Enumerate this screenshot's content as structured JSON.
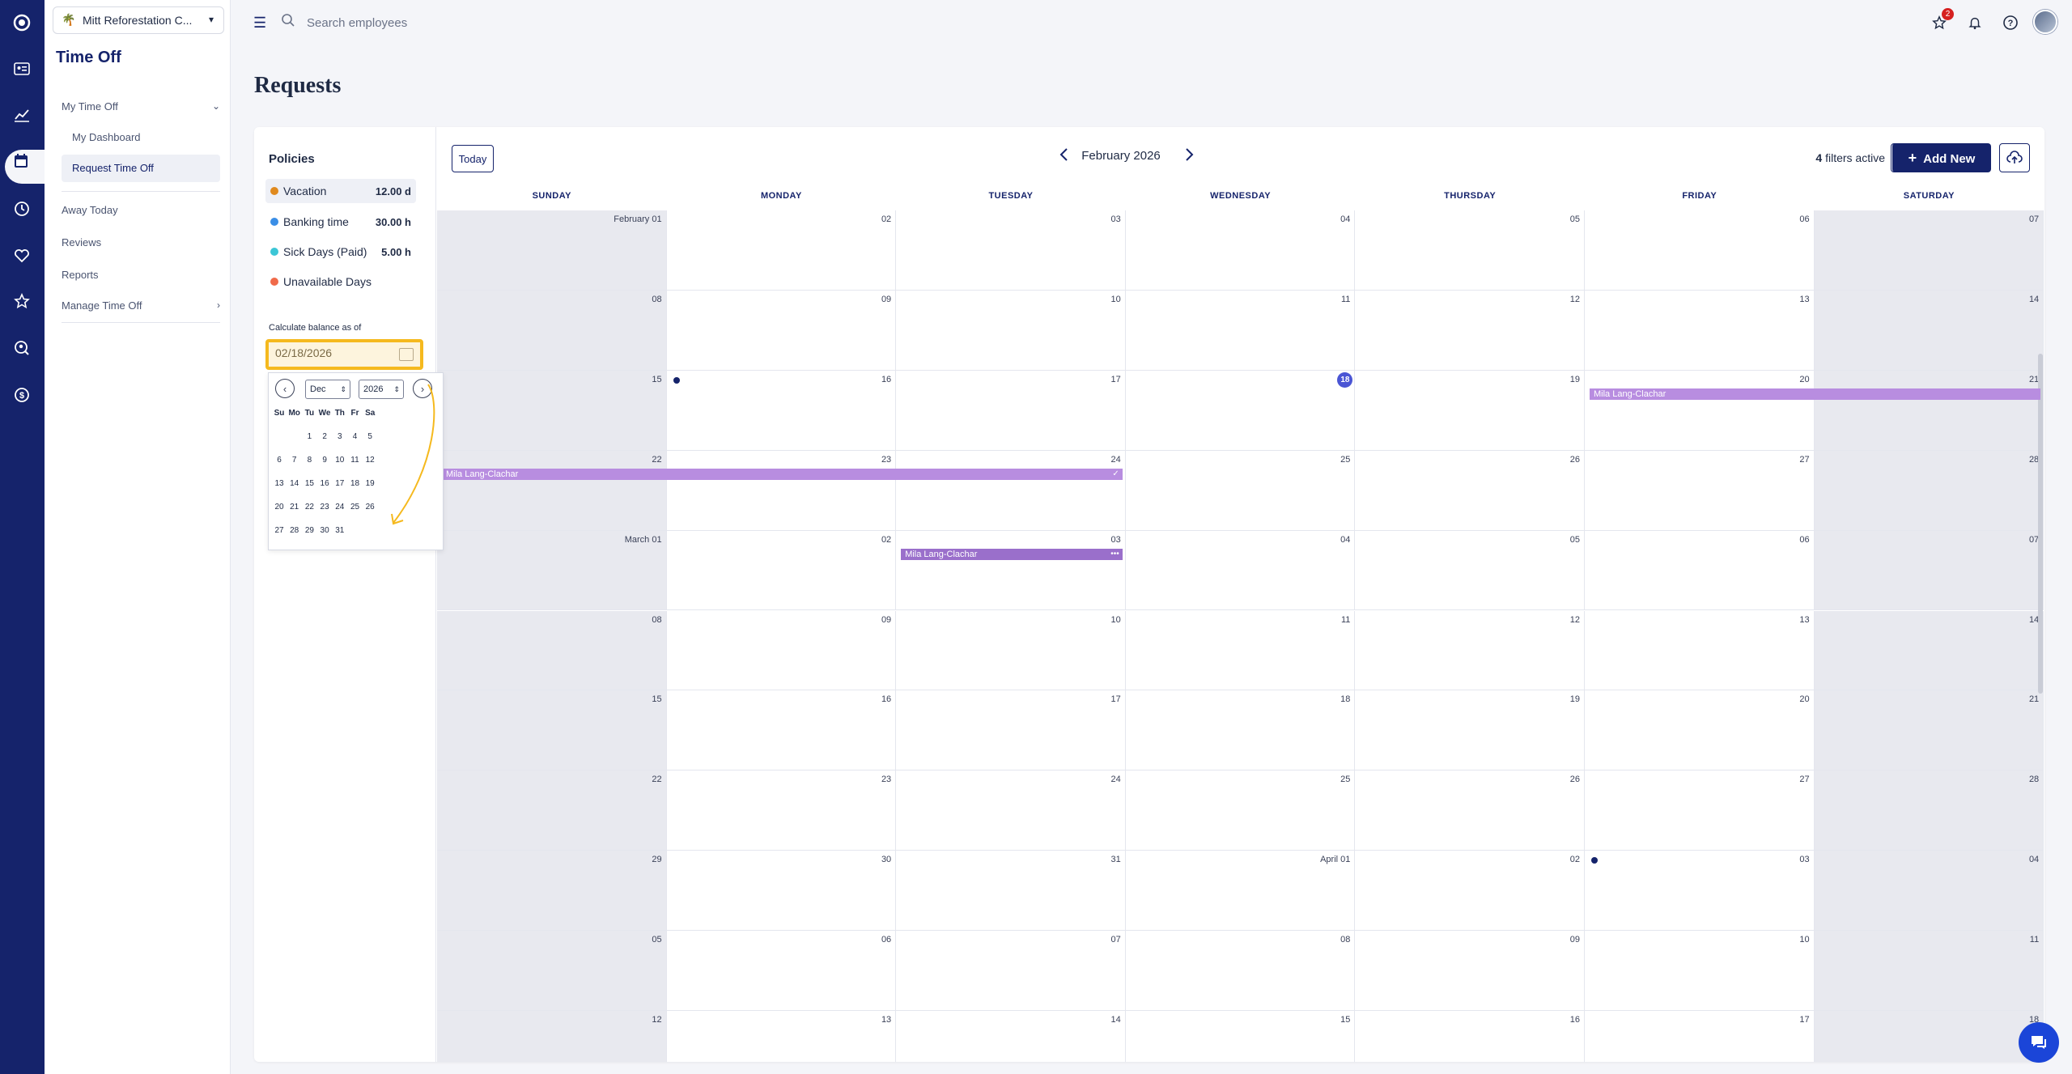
{
  "sidebar": {
    "company": "Mitt Reforestation C...",
    "section_title": "Time Off",
    "nav": {
      "my_time_off": "My Time Off",
      "my_dashboard": "My Dashboard",
      "request_time_off": "Request Time Off",
      "away_today": "Away Today",
      "reviews": "Reviews",
      "reports": "Reports",
      "manage_time_off": "Manage Time Off"
    }
  },
  "topbar": {
    "search_placeholder": "Search employees",
    "notification_badge": "2"
  },
  "page": {
    "title": "Requests"
  },
  "policies": {
    "title": "Policies",
    "items": [
      {
        "name": "Vacation",
        "amount": "12.00 d",
        "color": "#e08a1e"
      },
      {
        "name": "Banking time",
        "amount": "30.00 h",
        "color": "#3a8ee6"
      },
      {
        "name": "Sick Days (Paid)",
        "amount": "5.00 h",
        "color": "#3cc6d6"
      },
      {
        "name": "Unavailable Days",
        "amount": "",
        "color": "#f06a4a"
      }
    ],
    "calc_label": "Calculate balance as of",
    "date_value": "02/18/2026"
  },
  "datepicker": {
    "month": "Dec",
    "year": "2026",
    "weekdays": [
      "Su",
      "Mo",
      "Tu",
      "We",
      "Th",
      "Fr",
      "Sa"
    ],
    "weeks": [
      [
        "",
        "",
        "1",
        "2",
        "3",
        "4",
        "5"
      ],
      [
        "6",
        "7",
        "8",
        "9",
        "10",
        "11",
        "12"
      ],
      [
        "13",
        "14",
        "15",
        "16",
        "17",
        "18",
        "19"
      ],
      [
        "20",
        "21",
        "22",
        "23",
        "24",
        "25",
        "26"
      ],
      [
        "27",
        "28",
        "29",
        "30",
        "31",
        "",
        ""
      ]
    ]
  },
  "calendar": {
    "today_label": "Today",
    "month_label": "February 2026",
    "filters_count": "4",
    "filters_text": "filters active",
    "add_new_label": "Add New",
    "days_of_week": [
      "SUNDAY",
      "MONDAY",
      "TUESDAY",
      "WEDNESDAY",
      "THURSDAY",
      "FRIDAY",
      "SATURDAY"
    ],
    "weeks": [
      [
        "February 01",
        "02",
        "03",
        "04",
        "05",
        "06",
        "07"
      ],
      [
        "08",
        "09",
        "10",
        "11",
        "12",
        "13",
        "14"
      ],
      [
        "15",
        "16",
        "17",
        "18",
        "19",
        "20",
        "21"
      ],
      [
        "22",
        "23",
        "24",
        "25",
        "26",
        "27",
        "28"
      ],
      [
        "March 01",
        "02",
        "03",
        "04",
        "05",
        "06",
        "07"
      ],
      [
        "08",
        "09",
        "10",
        "11",
        "12",
        "13",
        "14"
      ],
      [
        "15",
        "16",
        "17",
        "18",
        "19",
        "20",
        "21"
      ],
      [
        "22",
        "23",
        "24",
        "25",
        "26",
        "27",
        "28"
      ],
      [
        "29",
        "30",
        "31",
        "April 01",
        "02",
        "03",
        "04"
      ],
      [
        "05",
        "06",
        "07",
        "08",
        "09",
        "10",
        "11"
      ],
      [
        "12",
        "13",
        "14",
        "15",
        "16",
        "17",
        "18"
      ]
    ],
    "today": {
      "week": 2,
      "day": 3
    },
    "events": [
      {
        "name": "Mila Lang-Clachar",
        "week": 2,
        "start": 5,
        "end": 6,
        "status": ""
      },
      {
        "name": "Mila Lang-Clachar",
        "week": 3,
        "start": 0,
        "end": 2,
        "status": "approved"
      },
      {
        "name": "Mila Lang-Clachar",
        "week": 4,
        "start": 2,
        "end": 2,
        "status": "pending"
      }
    ],
    "dots": [
      {
        "week": 2,
        "day": 1
      },
      {
        "week": 8,
        "day": 5
      }
    ]
  },
  "colors": {
    "brand": "#15236b",
    "accent": "#4a55d4",
    "highlight": "#f5b91e"
  }
}
